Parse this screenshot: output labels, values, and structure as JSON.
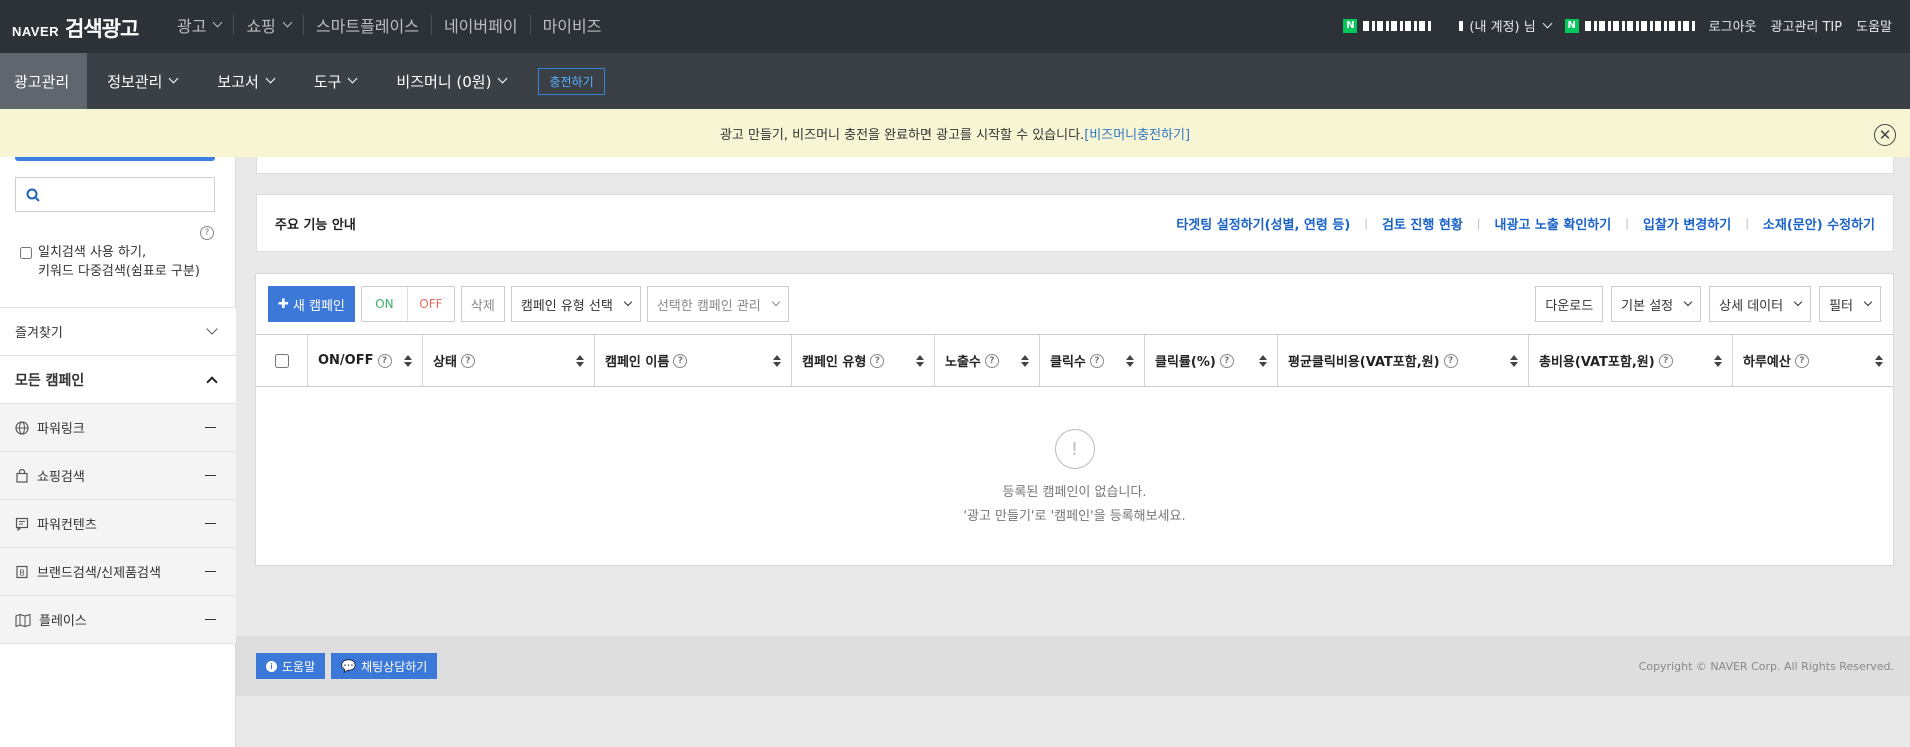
{
  "header": {
    "brand_naver": "NAVER",
    "brand_title": "검색광고",
    "nav": [
      {
        "label": "광고",
        "dropdown": true
      },
      {
        "label": "쇼핑",
        "dropdown": true
      },
      {
        "label": "스마트플레이스",
        "dropdown": false
      },
      {
        "label": "네이버페이",
        "dropdown": false
      },
      {
        "label": "마이비즈",
        "dropdown": false
      }
    ],
    "account_suffix": "(내 계정) 님",
    "logout": "로그아웃",
    "tip": "광고관리 TIP",
    "help": "도움말"
  },
  "menubar": {
    "tabs": [
      {
        "label": "광고관리",
        "active": true
      },
      {
        "label": "정보관리",
        "dropdown": true
      },
      {
        "label": "보고서",
        "dropdown": true
      },
      {
        "label": "도구",
        "dropdown": true
      },
      {
        "label": "비즈머니 (0원)",
        "dropdown": true
      }
    ],
    "charge_button": "충전하기"
  },
  "notice": {
    "text": "광고 만들기, 비즈머니 충전을 완료하면 광고를 시작할 수 있습니다.",
    "link": "[비즈머니충전하기]"
  },
  "sidebar": {
    "search_placeholder": "",
    "exact_match_line1": "일치검색 사용 하기,",
    "exact_match_line2": "키워드 다중검색(쉼표로 구분)",
    "favorites": "즐겨찾기",
    "all_campaigns": "모든 캠페인",
    "campaign_types": [
      {
        "label": "파워링크",
        "icon": "globe-icon"
      },
      {
        "label": "쇼핑검색",
        "icon": "shopping-bag-icon"
      },
      {
        "label": "파워컨텐츠",
        "icon": "content-icon"
      },
      {
        "label": "브랜드검색/신제품검색",
        "icon": "brand-icon"
      },
      {
        "label": "플레이스",
        "icon": "map-icon"
      }
    ]
  },
  "feature_guide": {
    "title": "주요 기능 안내",
    "links": [
      "타겟팅 설정하기(성별, 연령 등)",
      "검토 진행 현황",
      "내광고 노출 확인하기",
      "입찰가 변경하기",
      "소재(문안) 수정하기"
    ]
  },
  "toolbar": {
    "new_campaign": "새 캠페인",
    "on": "ON",
    "off": "OFF",
    "delete": "삭제",
    "campaign_type_select": "캠페인 유형 선택",
    "manage_selected": "선택한 캠페인 관리",
    "download": "다운로드",
    "basic_settings": "기본 설정",
    "detail_data": "상세 데이터",
    "filter": "필터"
  },
  "table": {
    "columns": [
      "ON/OFF",
      "상태",
      "캠페인 이름",
      "캠페인 유형",
      "노출수",
      "클릭수",
      "클릭률(%)",
      "평균클릭비용(VAT포함,원)",
      "총비용(VAT포함,원)",
      "하루예산"
    ],
    "empty_line1": "등록된 캠페인이 없습니다.",
    "empty_line2": "'광고 만들기'로 '캠페인'을 등록해보세요."
  },
  "footer": {
    "help": "도움말",
    "chat": "채팅상담하기",
    "copyright": "Copyright © NAVER Corp. All Rights Reserved."
  },
  "colors": {
    "topbar": "#2d3238",
    "menubar": "#3a4046",
    "accent": "#3c78d8",
    "notice_bg": "#f7f5d3",
    "link": "#1b63c7",
    "naver_green": "#03c75a"
  }
}
